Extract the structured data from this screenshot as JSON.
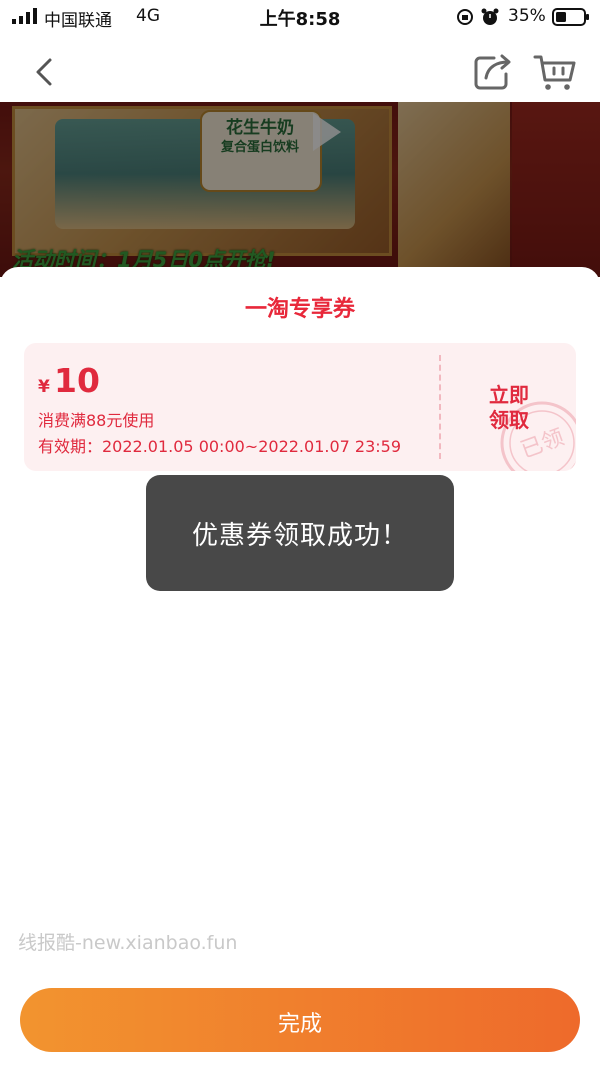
{
  "status_bar": {
    "carrier": "中国联通",
    "network": "4G",
    "time": "上午8:58",
    "battery": "35%"
  },
  "nav": {
    "icons": [
      "back-icon",
      "share-icon",
      "cart-icon"
    ]
  },
  "banner": {
    "product_name_line1": "花生牛奶",
    "product_name_line2": "复合蛋白饮料",
    "activity_text": "活动时间：1月5日0点开抢!"
  },
  "sheet": {
    "title": "一淘专享券"
  },
  "coupon": {
    "currency": "¥",
    "amount": "10",
    "condition": "消费满88元使用",
    "validity": "有效期：2022.01.05 00:00~2022.01.07 23:59",
    "claim_line1": "立即",
    "claim_line2": "领取",
    "stamp_text": "已领"
  },
  "toast": {
    "message": "优惠券领取成功！"
  },
  "watermark": "线报酷-new.xianbao.fun",
  "footer": {
    "done_label": "完成"
  },
  "colors": {
    "accent_red": "#e02a3e",
    "button_gradient_start": "#f2942f",
    "button_gradient_end": "#ee6a2b",
    "toast_bg": "#484848"
  }
}
